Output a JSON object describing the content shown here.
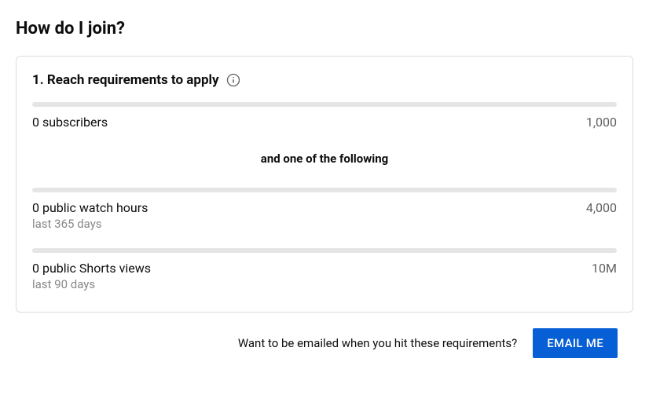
{
  "title": "How do I join?",
  "card": {
    "heading": "1. Reach requirements to apply",
    "separator": "and one of the following",
    "requirements": {
      "subscribers": {
        "label": "0 subscribers",
        "target": "1,000"
      },
      "watch_hours": {
        "label": "0 public watch hours",
        "sub": "last 365 days",
        "target": "4,000"
      },
      "shorts_views": {
        "label": "0 public Shorts views",
        "sub": "last 90 days",
        "target": "10M"
      }
    }
  },
  "email_prompt": {
    "text": "Want to be emailed when you hit these requirements?",
    "button": "EMAIL ME"
  }
}
